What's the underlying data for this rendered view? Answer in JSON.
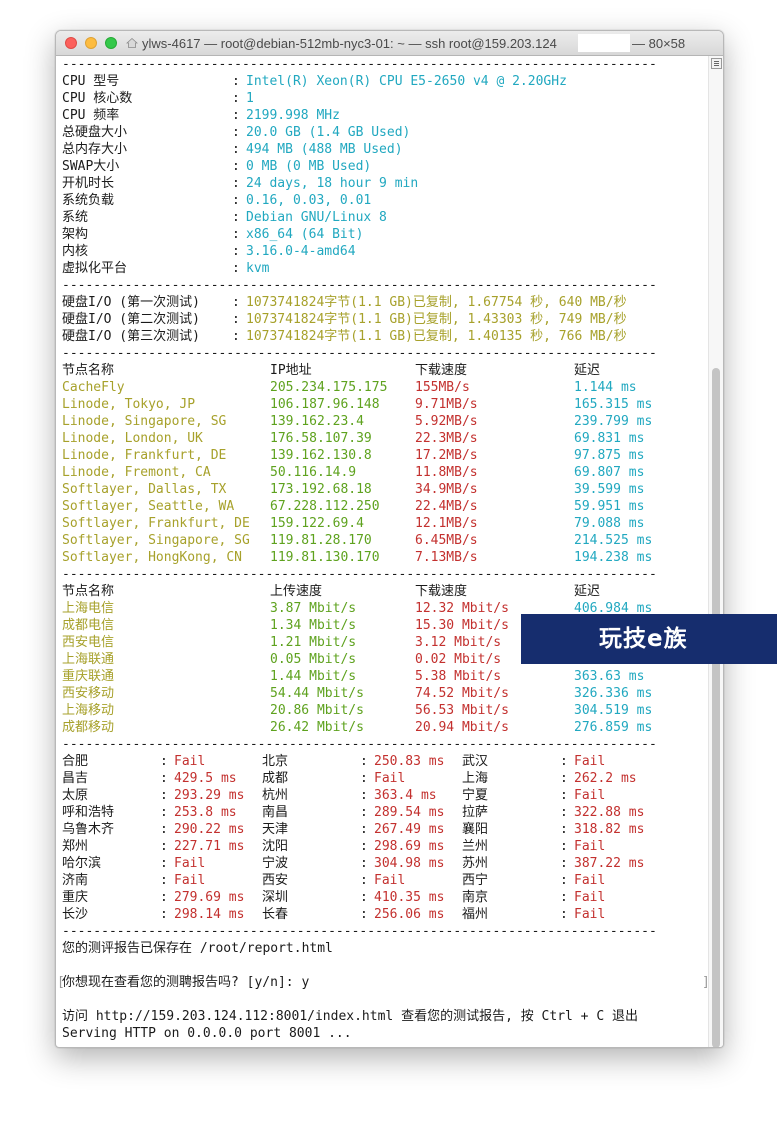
{
  "window": {
    "title": "ylws-4617 — root@debian-512mb-nyc3-01: ~ — ssh root@159.203.124",
    "size_text": "— 80×58"
  },
  "system_info": [
    {
      "label": "CPU 型号",
      "value": "Intel(R) Xeon(R) CPU E5-2650 v4 @ 2.20GHz"
    },
    {
      "label": "CPU 核心数",
      "value": "1"
    },
    {
      "label": "CPU 频率",
      "value": "2199.998 MHz"
    },
    {
      "label": "总硬盘大小",
      "value": "20.0 GB (1.4 GB Used)"
    },
    {
      "label": "总内存大小",
      "value": "494 MB (488 MB Used)"
    },
    {
      "label": "SWAP大小",
      "value": "0 MB (0 MB Used)"
    },
    {
      "label": "开机时长",
      "value": "24 days, 18 hour 9 min"
    },
    {
      "label": "系统负载",
      "value": "0.16, 0.03, 0.01"
    },
    {
      "label": "系统",
      "value": "Debian GNU/Linux 8"
    },
    {
      "label": "架构",
      "value": "x86_64 (64 Bit)"
    },
    {
      "label": "内核",
      "value": "3.16.0-4-amd64"
    },
    {
      "label": "虚拟化平台",
      "value": "kvm"
    }
  ],
  "disk_io": [
    {
      "label": "硬盘I/O (第一次测试)",
      "value": "1073741824字节(1.1 GB)已复制, 1.67754 秒, 640 MB/秒"
    },
    {
      "label": "硬盘I/O (第二次测试)",
      "value": "1073741824字节(1.1 GB)已复制, 1.43303 秒, 749 MB/秒"
    },
    {
      "label": "硬盘I/O (第三次测试)",
      "value": "1073741824字节(1.1 GB)已复制, 1.40135 秒, 766 MB/秒"
    }
  ],
  "download_table": {
    "headers": [
      "节点名称",
      "IP地址",
      "下载速度",
      "延迟"
    ],
    "rows": [
      [
        "CacheFly",
        "205.234.175.175",
        "155MB/s",
        "1.144 ms"
      ],
      [
        "Linode, Tokyo, JP",
        "106.187.96.148",
        "9.71MB/s",
        "165.315 ms"
      ],
      [
        "Linode, Singapore, SG",
        "139.162.23.4",
        "5.92MB/s",
        "239.799 ms"
      ],
      [
        "Linode, London, UK",
        "176.58.107.39",
        "22.3MB/s",
        "69.831 ms"
      ],
      [
        "Linode, Frankfurt, DE",
        "139.162.130.8",
        "17.2MB/s",
        "97.875 ms"
      ],
      [
        "Linode, Fremont, CA",
        "50.116.14.9",
        "11.8MB/s",
        "69.807 ms"
      ],
      [
        "Softlayer, Dallas, TX",
        "173.192.68.18",
        "34.9MB/s",
        "39.599 ms"
      ],
      [
        "Softlayer, Seattle, WA",
        "67.228.112.250",
        "22.4MB/s",
        "59.951 ms"
      ],
      [
        "Softlayer, Frankfurt, DE",
        "159.122.69.4",
        "12.1MB/s",
        "79.088 ms"
      ],
      [
        "Softlayer, Singapore, SG",
        "119.81.28.170",
        "6.45MB/s",
        "214.525 ms"
      ],
      [
        "Softlayer, HongKong, CN",
        "119.81.130.170",
        "7.13MB/s",
        "194.238 ms"
      ]
    ]
  },
  "speed_table": {
    "headers": [
      "节点名称",
      "上传速度",
      "下载速度",
      "延迟"
    ],
    "rows": [
      [
        "上海电信",
        "3.87 Mbit/s",
        "12.32 Mbit/s",
        "406.984 ms"
      ],
      [
        "成都电信",
        "1.34 Mbit/s",
        "15.30 Mbit/s",
        ""
      ],
      [
        "西安电信",
        "1.21 Mbit/s",
        "3.12 Mbit/s",
        ""
      ],
      [
        "上海联通",
        "0.05 Mbit/s",
        "0.02 Mbit/s",
        ""
      ],
      [
        "重庆联通",
        "1.44 Mbit/s",
        "5.38 Mbit/s",
        "363.63 ms"
      ],
      [
        "西安移动",
        "54.44 Mbit/s",
        "74.52 Mbit/s",
        "326.336 ms"
      ],
      [
        "上海移动",
        "20.86 Mbit/s",
        "56.53 Mbit/s",
        "304.519 ms"
      ],
      [
        "成都移动",
        "26.42 Mbit/s",
        "20.94 Mbit/s",
        "276.859 ms"
      ]
    ]
  },
  "ping_table": [
    [
      [
        "合肥",
        "Fail"
      ],
      [
        "北京",
        "250.83 ms"
      ],
      [
        "武汉",
        "Fail"
      ]
    ],
    [
      [
        "昌吉",
        "429.5 ms"
      ],
      [
        "成都",
        "Fail"
      ],
      [
        "上海",
        "262.2 ms"
      ]
    ],
    [
      [
        "太原",
        "293.29 ms"
      ],
      [
        "杭州",
        "363.4 ms"
      ],
      [
        "宁夏",
        "Fail"
      ]
    ],
    [
      [
        "呼和浩特",
        "253.8 ms"
      ],
      [
        "南昌",
        "289.54 ms"
      ],
      [
        "拉萨",
        "322.88 ms"
      ]
    ],
    [
      [
        "乌鲁木齐",
        "290.22 ms"
      ],
      [
        "天津",
        "267.49 ms"
      ],
      [
        "襄阳",
        "318.82 ms"
      ]
    ],
    [
      [
        "郑州",
        "227.71 ms"
      ],
      [
        "沈阳",
        "298.69 ms"
      ],
      [
        "兰州",
        "Fail"
      ]
    ],
    [
      [
        "哈尔滨",
        "Fail"
      ],
      [
        "宁波",
        "304.98 ms"
      ],
      [
        "苏州",
        "387.22 ms"
      ]
    ],
    [
      [
        "济南",
        "Fail"
      ],
      [
        "西安",
        "Fail"
      ],
      [
        "西宁",
        "Fail"
      ]
    ],
    [
      [
        "重庆",
        "279.69 ms"
      ],
      [
        "深圳",
        "410.35 ms"
      ],
      [
        "南京",
        "Fail"
      ]
    ],
    [
      [
        "长沙",
        "298.14 ms"
      ],
      [
        "长春",
        "256.06 ms"
      ],
      [
        "福州",
        "Fail"
      ]
    ]
  ],
  "footer": {
    "report_saved": "您的测评报告已保存在 /root/report.html",
    "prompt": "你想现在查看您的测聘报告吗? [y/n]: y",
    "visit": "访问 http://159.203.124.112:8001/index.html 查看您的测试报告, 按 Ctrl + C 退出",
    "serving": "Serving HTTP on 0.0.0.0 port 8001 ..."
  },
  "watermark": "玩技e族",
  "colors": {
    "value_cyan": "#21a8c0",
    "olive": "#a7a12b",
    "green": "#5ea21e",
    "red": "#c3302e",
    "watermark_bg": "#162d6e"
  }
}
